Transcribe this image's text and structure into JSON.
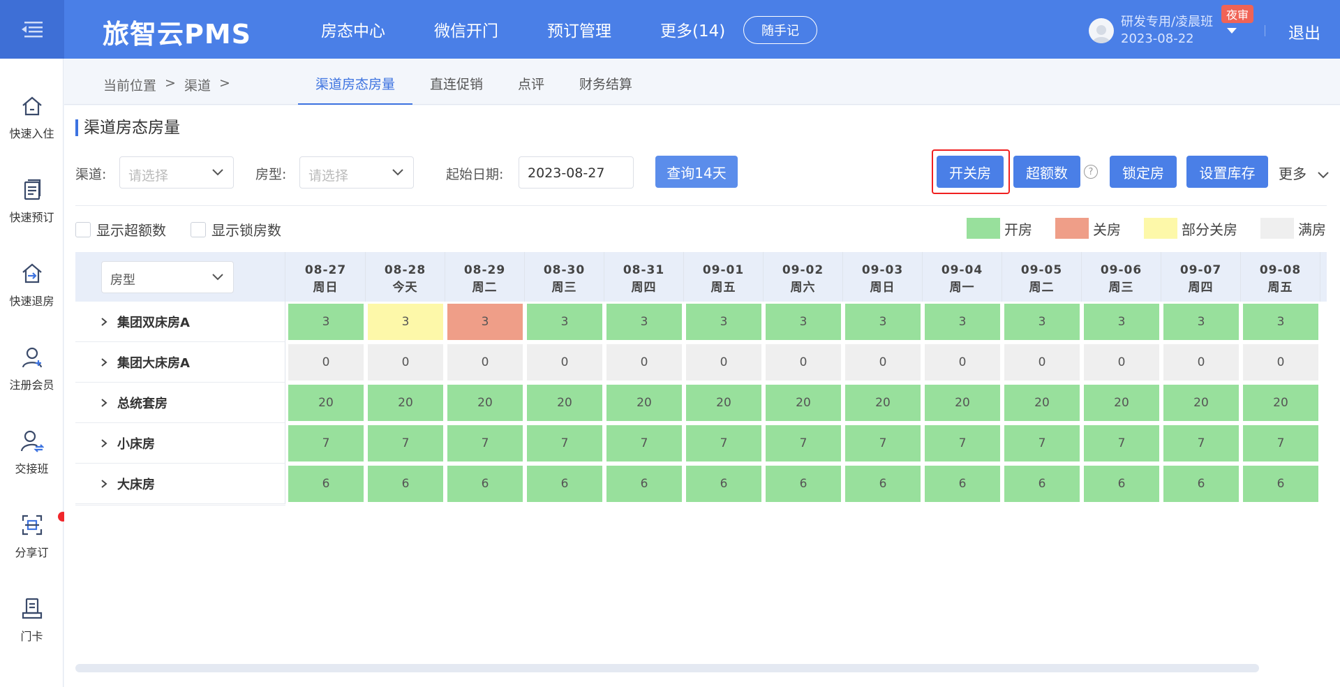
{
  "header": {
    "brand": "旅智云PMS",
    "nav": [
      "房态中心",
      "微信开门",
      "预订管理",
      "更多(14)"
    ],
    "notes_button": "随手记",
    "user_name": "研发专用/凌晨班",
    "user_date": "2023-08-22",
    "shift_badge": "夜审",
    "logout": "退出"
  },
  "sidebar": {
    "items": [
      {
        "label": "快速入住",
        "icon": "home-icon"
      },
      {
        "label": "快速预订",
        "icon": "booking-icon"
      },
      {
        "label": "快速退房",
        "icon": "checkout-icon"
      },
      {
        "label": "注册会员",
        "icon": "member-icon"
      },
      {
        "label": "交接班",
        "icon": "shift-icon"
      },
      {
        "label": "分享订",
        "icon": "share-icon"
      },
      {
        "label": "门卡",
        "icon": "card-icon"
      }
    ]
  },
  "breadcrumb": {
    "prefix": "当前位置",
    "sep": ">",
    "level1": "渠道",
    "sep2": ">"
  },
  "tabs": [
    "渠道房态房量",
    "直连促销",
    "点评",
    "财务结算"
  ],
  "panel": {
    "title": "渠道房态房量",
    "channel_label": "渠道:",
    "channel_placeholder": "请选择",
    "roomtype_label": "房型:",
    "roomtype_placeholder": "请选择",
    "startdate_label": "起始日期:",
    "startdate_value": "2023-08-27",
    "query_button": "查询14天",
    "toggle_button": "开关房",
    "overbook_button": "超额数",
    "lock_button": "锁定房",
    "inventory_button": "设置库存",
    "more_label": "更多",
    "show_overbook": "显示超额数",
    "show_locked": "显示锁房数"
  },
  "legend": [
    {
      "label": "开房",
      "color": "#98e09c"
    },
    {
      "label": "关房",
      "color": "#ef9e88"
    },
    {
      "label": "部分关房",
      "color": "#fdf8a9"
    },
    {
      "label": "满房",
      "color": "#efefef"
    }
  ],
  "grid": {
    "roomtype_select": "房型",
    "days": [
      {
        "date": "08-27",
        "week": "周日"
      },
      {
        "date": "08-28",
        "week": "今天"
      },
      {
        "date": "08-29",
        "week": "周二"
      },
      {
        "date": "08-30",
        "week": "周三"
      },
      {
        "date": "08-31",
        "week": "周四"
      },
      {
        "date": "09-01",
        "week": "周五"
      },
      {
        "date": "09-02",
        "week": "周六"
      },
      {
        "date": "09-03",
        "week": "周日"
      },
      {
        "date": "09-04",
        "week": "周一"
      },
      {
        "date": "09-05",
        "week": "周二"
      },
      {
        "date": "09-06",
        "week": "周三"
      },
      {
        "date": "09-07",
        "week": "周四"
      },
      {
        "date": "09-08",
        "week": "周五"
      }
    ],
    "rows": [
      {
        "name": "集团双床房A",
        "values": [
          "3",
          "3",
          "3",
          "3",
          "3",
          "3",
          "3",
          "3",
          "3",
          "3",
          "3",
          "3",
          "3"
        ],
        "status": [
          "g",
          "y",
          "r",
          "g",
          "g",
          "g",
          "g",
          "g",
          "g",
          "g",
          "g",
          "g",
          "g"
        ]
      },
      {
        "name": "集团大床房A",
        "values": [
          "0",
          "0",
          "0",
          "0",
          "0",
          "0",
          "0",
          "0",
          "0",
          "0",
          "0",
          "0",
          "0"
        ],
        "status": [
          "e",
          "e",
          "e",
          "e",
          "e",
          "e",
          "e",
          "e",
          "e",
          "e",
          "e",
          "e",
          "e"
        ]
      },
      {
        "name": "总统套房",
        "values": [
          "20",
          "20",
          "20",
          "20",
          "20",
          "20",
          "20",
          "20",
          "20",
          "20",
          "20",
          "20",
          "20"
        ],
        "status": [
          "g",
          "g",
          "g",
          "g",
          "g",
          "g",
          "g",
          "g",
          "g",
          "g",
          "g",
          "g",
          "g"
        ]
      },
      {
        "name": "小床房",
        "values": [
          "7",
          "7",
          "7",
          "7",
          "7",
          "7",
          "7",
          "7",
          "7",
          "7",
          "7",
          "7",
          "7"
        ],
        "status": [
          "g",
          "g",
          "g",
          "g",
          "g",
          "g",
          "g",
          "g",
          "g",
          "g",
          "g",
          "g",
          "g"
        ]
      },
      {
        "name": "大床房",
        "values": [
          "6",
          "6",
          "6",
          "6",
          "6",
          "6",
          "6",
          "6",
          "6",
          "6",
          "6",
          "6",
          "6"
        ],
        "status": [
          "g",
          "g",
          "g",
          "g",
          "g",
          "g",
          "g",
          "g",
          "g",
          "g",
          "g",
          "g",
          "g"
        ]
      }
    ]
  }
}
